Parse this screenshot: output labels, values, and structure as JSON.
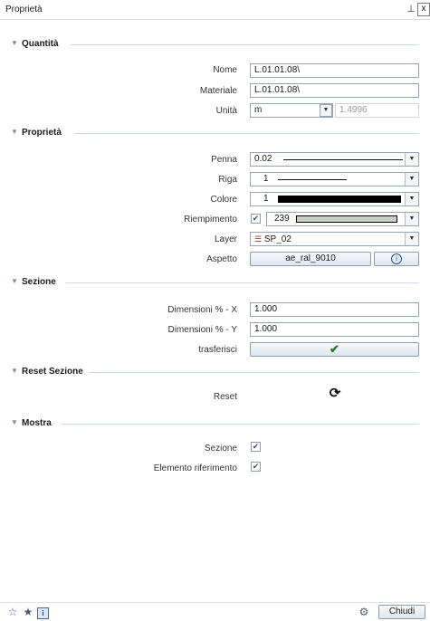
{
  "window": {
    "title": "Proprietà",
    "pin_glyph": "⊥",
    "close_glyph": "x"
  },
  "colors": {
    "accent": "#2a7a2a",
    "section_line": "#cfd8e4",
    "fill_color_sample": "#c8cdc5"
  },
  "sections": {
    "quantita": {
      "label": "Quantità",
      "nome_label": "Nome",
      "nome_value": "L.01.01.08\\",
      "materiale_label": "Materiale",
      "materiale_value": "L.01.01.08\\",
      "unita_label": "Unità",
      "unita_value": "m",
      "unita_extra": "1.4996"
    },
    "proprieta": {
      "label": "Proprietà",
      "penna_label": "Penna",
      "penna_value": "0.02",
      "riga_label": "Riga",
      "riga_value": "1",
      "colore_label": "Colore",
      "colore_value": "1",
      "riempimento_label": "Riempimento",
      "riempimento_checked": true,
      "riempimento_value": "239",
      "layer_label": "Layer",
      "layer_value": "SP_02",
      "aspetto_label": "Aspetto",
      "aspetto_value": "ae_ral_9010",
      "info_glyph": "i"
    },
    "sezione": {
      "label": "Sezione",
      "dimx_label": "Dimensioni % - X",
      "dimx_value": "1.000",
      "dimy_label": "Dimensioni % - Y",
      "dimy_value": "1.000",
      "trasferisci_label": "trasferisci",
      "trasferisci_glyph": "✔"
    },
    "reset_sezione": {
      "label": "Reset Sezione",
      "reset_label": "Reset",
      "reset_glyph": "⟳"
    },
    "mostra": {
      "label": "Mostra",
      "sezione_label": "Sezione",
      "sezione_checked": true,
      "elemento_label": "Elemento riferimento",
      "elemento_checked": true
    }
  },
  "footer": {
    "close_label": "Chiudi"
  }
}
